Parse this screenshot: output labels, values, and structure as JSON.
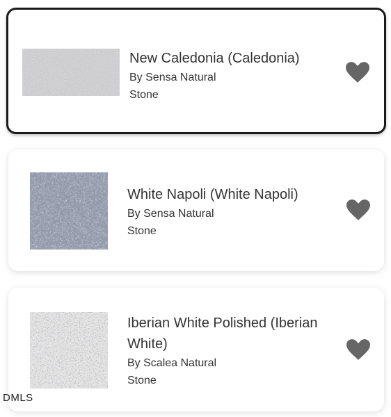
{
  "listings": [
    {
      "title": "New Caledonia (Caledonia)",
      "brand": "By Sensa Natural",
      "material": "Stone",
      "swatch_icon": "light-gray-granite-swatch",
      "favorite_icon": "heart-icon",
      "selected": true
    },
    {
      "title": "White Napoli (White Napoli)",
      "brand": "By Sensa Natural",
      "material": "Stone",
      "swatch_icon": "blue-gray-granite-swatch",
      "favorite_icon": "heart-icon",
      "selected": false
    },
    {
      "title": "Iberian White Polished (Iberian White)",
      "brand": "By Scalea Natural",
      "material": "Stone",
      "swatch_icon": "speckled-white-granite-swatch",
      "favorite_icon": "heart-icon",
      "selected": false
    }
  ],
  "watermark": "DMLS",
  "colors": {
    "heart": "#666666",
    "selected_border": "#1a1a1a",
    "text": "#333333"
  }
}
